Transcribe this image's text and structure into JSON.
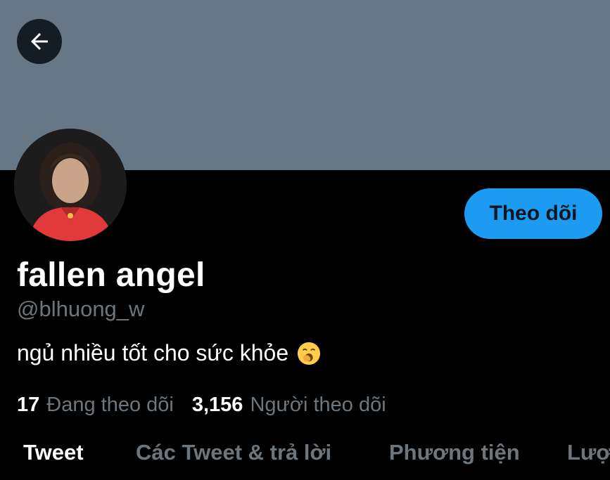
{
  "header": {
    "back_icon": "arrow-left-icon"
  },
  "profile": {
    "display_name": "fallen angel",
    "handle": "@blhuong_w",
    "bio": "ngủ nhiều tốt cho sức khỏe",
    "bio_emoji": "yawning-face-emoji",
    "follow_label": "Theo dõi"
  },
  "stats": {
    "following_count": "17",
    "following_label": "Đang theo dõi",
    "followers_count": "3,156",
    "followers_label": "Người theo dõi"
  },
  "tabs": [
    {
      "label": "Tweet",
      "active": true
    },
    {
      "label": "Các Tweet & trả lời",
      "active": false
    },
    {
      "label": "Phương tiện",
      "active": false
    },
    {
      "label": "Lượt",
      "active": false
    }
  ],
  "colors": {
    "banner": "#667886",
    "accent": "#1d9bf0",
    "background": "#000000",
    "secondary_text": "#6e767d"
  }
}
